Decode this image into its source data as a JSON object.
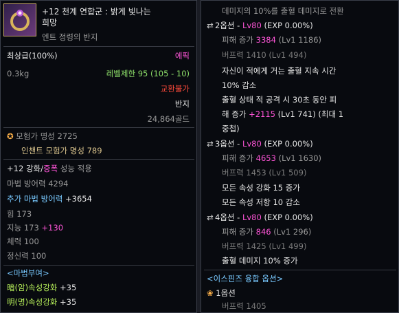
{
  "left": {
    "item_name_line1": "+12 천계 연합군 : 밝게 빛나는",
    "item_name_line2": "희망",
    "item_subtitle": "엔트 정령의 반지",
    "grade": "최상급(100%)",
    "rarity": "에픽",
    "weight": "0.3kg",
    "level_limit": "레벨제한 95 (105 - 10)",
    "trade": "교환불가",
    "slot_type": "반지",
    "price": "24,864골드",
    "adventurer_fame": "모험가 명성 2725",
    "enchant_fame": "인챈트 모험가 명성 789",
    "enhance_prefix": "+12 ",
    "enhance_word": "강화",
    "enhance_slash": "/",
    "amplify_word": "증폭",
    "enhance_suffix": " 성능 적용",
    "magic_def": "마법 방어력 4294",
    "extra_magic_def_label": "추가 마법 방어력 ",
    "extra_magic_def_value": "+3654",
    "strength": "힘 173",
    "intelligence_label": "지능 173 ",
    "intelligence_bonus": "+130",
    "vitality": "체력 100",
    "spirit": "정신력 100",
    "magic_grant_header": "<마법부여>",
    "dark_label": "暗(암)속성강화 ",
    "dark_value": "+35",
    "light_label": "明(명)속성강화 ",
    "light_value": "+35"
  },
  "right": {
    "line_top": "데미지의 10%를 출혈 데미지로 전환",
    "opt2_head": "2옵션 - ",
    "opt2_lv": "Lv80",
    "opt2_exp": " (EXP 0.00%)",
    "opt2_dmg_label": "피해 증가 ",
    "opt2_dmg_value": "3384",
    "opt2_dmg_lv": " (Lv1 1186)",
    "opt2_buff": "버프력 1410 (Lv1 494)",
    "opt2_desc1": "자신이 적에게 거는 출혈 지속 시간",
    "opt2_desc2": "10% 감소",
    "opt2_desc3": "출혈 상태 적 공격 시 30초 동안 피",
    "opt2_desc4_label": "해 증가 ",
    "opt2_desc4_value": "+2115",
    "opt2_desc4_tail": " (Lv1 741) (최대 1",
    "opt2_desc5": "중첩)",
    "opt3_head": "3옵션 - ",
    "opt3_lv": "Lv80",
    "opt3_exp": " (EXP 0.00%)",
    "opt3_dmg_label": "피해 증가 ",
    "opt3_dmg_value": "4653",
    "opt3_dmg_lv": " (Lv1 1630)",
    "opt3_buff": "버프력 1453 (Lv1 509)",
    "opt3_desc1": "모든 속성 강화 15 증가",
    "opt3_desc2": "모든 속성 저항 10 감소",
    "opt4_head": "4옵션 - ",
    "opt4_lv": "Lv80",
    "opt4_exp": " (EXP 0.00%)",
    "opt4_dmg_label": "피해 증가 ",
    "opt4_dmg_value": "846",
    "opt4_dmg_lv": " (Lv1 296)",
    "opt4_buff": "버프력 1425 (Lv1 499)",
    "opt4_desc1": "출혈 데미지 10% 증가",
    "fusion_header": "<이스핀즈 융합 옵션>",
    "fusion_opt1": "1옵션",
    "fusion_buff": "버프력 1405"
  },
  "icons": {
    "swap": "⇄",
    "fame": "✪",
    "rose": "❀"
  }
}
